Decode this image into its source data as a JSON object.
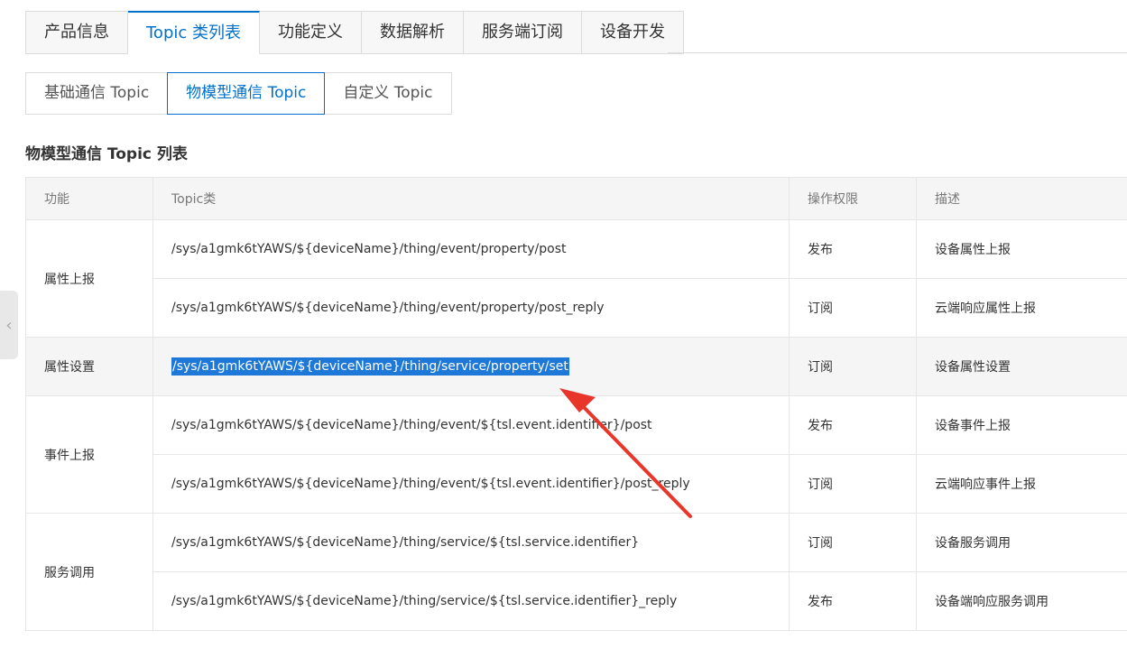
{
  "tabs_main": [
    "产品信息",
    "Topic 类列表",
    "功能定义",
    "数据解析",
    "服务端订阅",
    "设备开发"
  ],
  "tabs_sub": [
    "基础通信 Topic",
    "物模型通信 Topic",
    "自定义 Topic"
  ],
  "section_title": "物模型通信 Topic 列表",
  "table": {
    "headers": [
      "功能",
      "Topic类",
      "操作权限",
      "描述"
    ],
    "groups": [
      {
        "function": "属性上报",
        "rows": [
          {
            "topic": "/sys/a1gmk6tYAWS/${deviceName}/thing/event/property/post",
            "permission": "发布",
            "description": "设备属性上报"
          },
          {
            "topic": "/sys/a1gmk6tYAWS/${deviceName}/thing/event/property/post_reply",
            "permission": "订阅",
            "description": "云端响应属性上报"
          }
        ]
      },
      {
        "function": "属性设置",
        "rows": [
          {
            "topic": "/sys/a1gmk6tYAWS/${deviceName}/thing/service/property/set",
            "permission": "订阅",
            "description": "设备属性设置"
          }
        ]
      },
      {
        "function": "事件上报",
        "rows": [
          {
            "topic": "/sys/a1gmk6tYAWS/${deviceName}/thing/event/${tsl.event.identifier}/post",
            "permission": "发布",
            "description": "设备事件上报"
          },
          {
            "topic": "/sys/a1gmk6tYAWS/${deviceName}/thing/event/${tsl.event.identifier}/post_reply",
            "permission": "订阅",
            "description": "云端响应事件上报"
          }
        ]
      },
      {
        "function": "服务调用",
        "rows": [
          {
            "topic": "/sys/a1gmk6tYAWS/${deviceName}/thing/service/${tsl.service.identifier}",
            "permission": "订阅",
            "description": "设备服务调用"
          },
          {
            "topic": "/sys/a1gmk6tYAWS/${deviceName}/thing/service/${tsl.service.identifier}_reply",
            "permission": "发布",
            "description": "设备端响应服务调用"
          }
        ]
      }
    ]
  },
  "colors": {
    "accent": "#0070cc",
    "selection": "#1e78d7",
    "annotation_arrow": "#e8362b"
  },
  "icons": {
    "collapse_handle": "chevron-left-icon"
  }
}
